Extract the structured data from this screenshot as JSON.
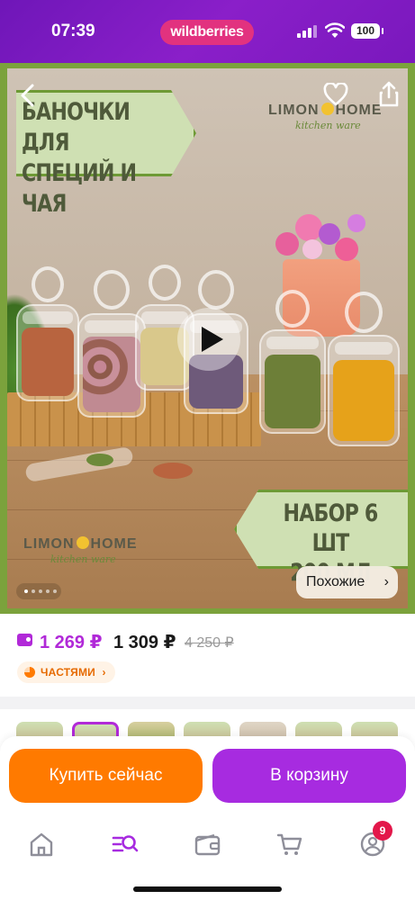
{
  "status_bar": {
    "time": "07:39",
    "app_pill": "wildberries",
    "battery": "100"
  },
  "product_image": {
    "title_banner": "БАНОЧКИ ДЛЯ СПЕЦИЙ И ЧАЯ",
    "logo_top": {
      "word_left": "LIMON",
      "word_right": "HOME",
      "subtitle": "kitchen ware"
    },
    "logo_bottom": {
      "word_left": "LIMON",
      "word_right": "HOME",
      "subtitle": "kitchen ware"
    },
    "set_banner_line1": "НАБОР 6 ШТ",
    "set_banner_line2": "200 МЛ",
    "similar_button": "Похожие",
    "similar_chevron": "›",
    "icons": [
      "back-arrow-icon",
      "heart-icon",
      "share-icon",
      "play-icon"
    ]
  },
  "price": {
    "wallet_price": "1 269 ₽",
    "current_price": "1 309 ₽",
    "old_price": "4 250 ₽",
    "installments_label": "ЧАСТЯМИ",
    "installments_chevron": "›"
  },
  "actions": {
    "buy_now": "Купить сейчас",
    "add_to_cart": "В корзину"
  },
  "tab_bar": {
    "items": [
      "home-icon",
      "catalog-search-icon",
      "wallet-icon",
      "cart-icon",
      "profile-icon"
    ],
    "active": "catalog-search-icon",
    "profile_badge": "9"
  },
  "colors": {
    "brand_purple": "#a72be0",
    "orange": "#ff7a00",
    "wallet_purple": "#b129d8",
    "badge_red": "#e3174a"
  }
}
